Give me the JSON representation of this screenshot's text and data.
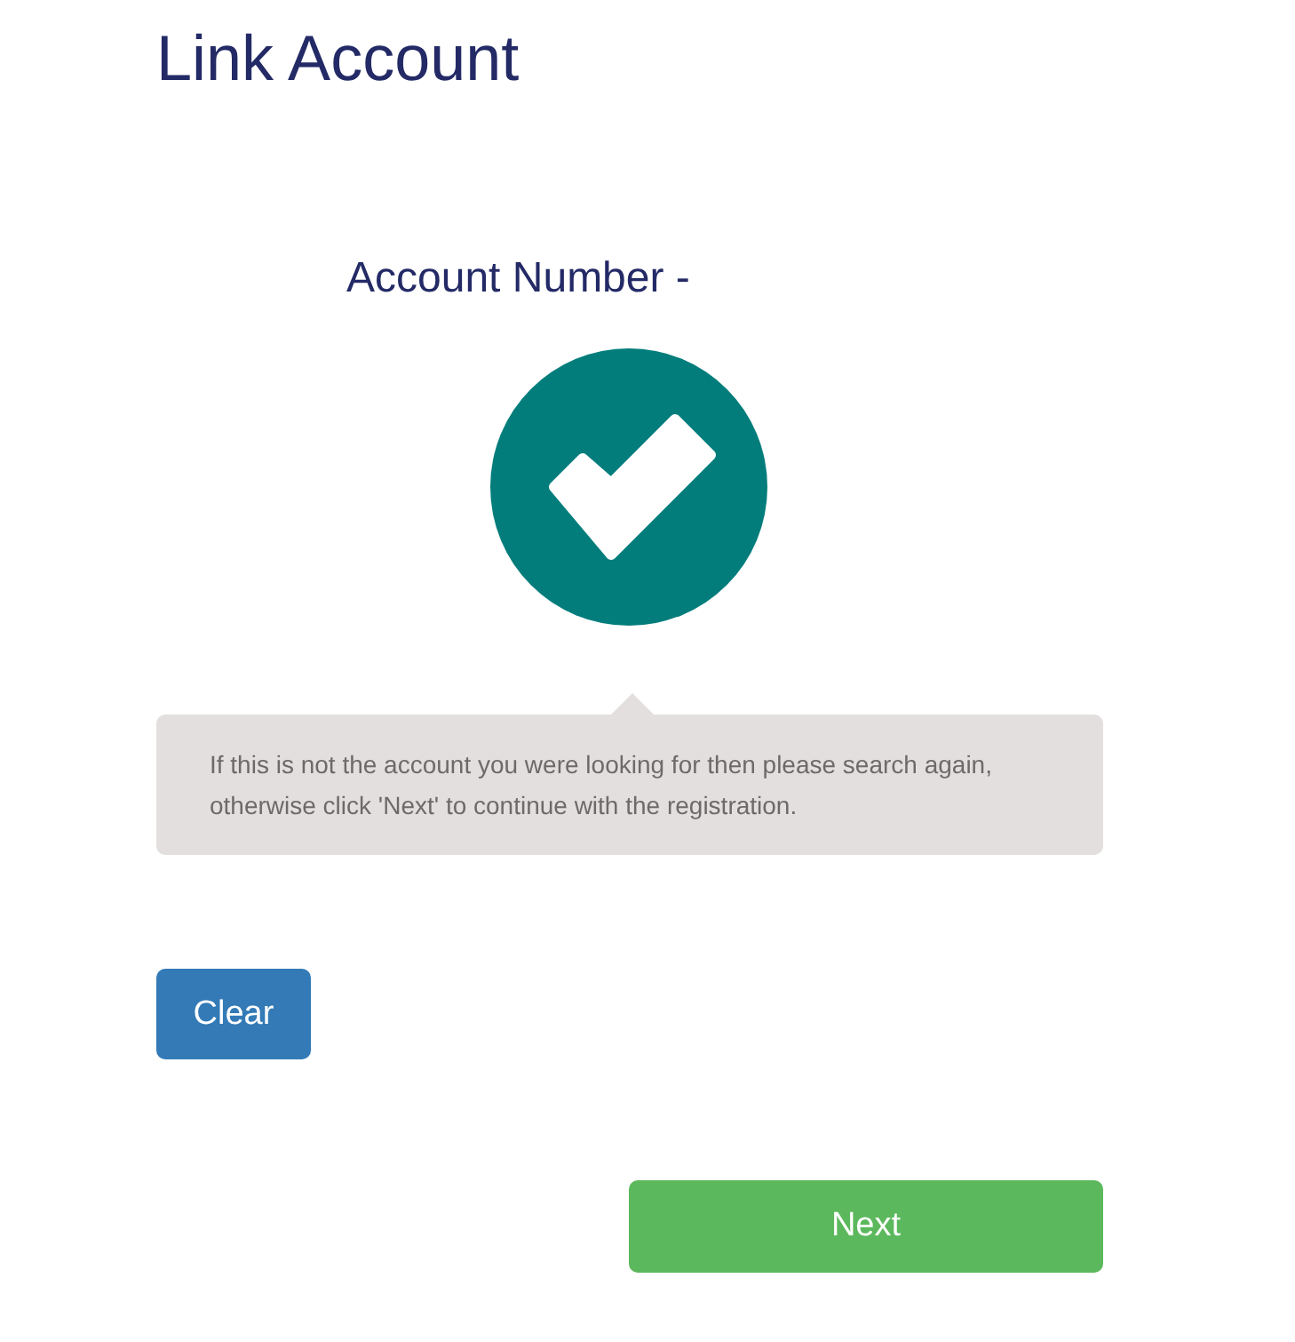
{
  "title": "Link Account",
  "account_label": "Account Number -",
  "status": {
    "kind": "success"
  },
  "message": "If this is not the account you were looking for then please search again, otherwise click 'Next' to continue with the registration.",
  "buttons": [
    {
      "label": "Clear",
      "kind": "primary"
    },
    {
      "label": "Next",
      "kind": "success"
    }
  ]
}
